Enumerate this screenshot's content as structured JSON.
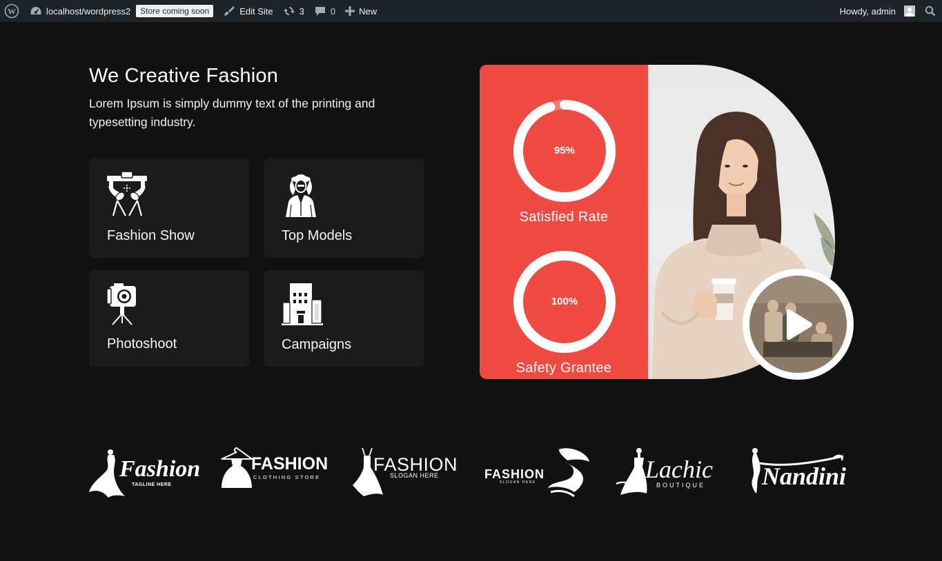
{
  "adminbar": {
    "site_name": "localhost/wordpress2",
    "store_badge": "Store coming soon",
    "edit_site": "Edit Site",
    "updates_count": "3",
    "comments_count": "0",
    "new_label": "New",
    "howdy": "Howdy, admin",
    "icons": [
      "wordpress-icon",
      "dashboard-icon",
      "brush-icon",
      "refresh-icon",
      "comment-icon",
      "plus-icon",
      "search-icon"
    ]
  },
  "hero": {
    "title": "We Creative Fashion",
    "text": "Lorem Ipsum is simply dummy text of the printing and typesetting industry."
  },
  "services": [
    {
      "label": "Fashion Show",
      "icon": "runway-lights-icon"
    },
    {
      "label": "Top Models",
      "icon": "model-icon"
    },
    {
      "label": "Photoshoot",
      "icon": "camera-tripod-icon"
    },
    {
      "label": "Campaigns",
      "icon": "building-icon"
    }
  ],
  "stats": [
    {
      "value": "95%",
      "label": "Satisfied Rate",
      "progress": 0.95
    },
    {
      "value": "100%",
      "label": "Safety Grantee",
      "progress": 1.0
    }
  ],
  "logos": [
    {
      "name": "Fashion",
      "tagline": "TAGLINE HERE"
    },
    {
      "name": "FASHION",
      "tagline": "CLOTHING STORE"
    },
    {
      "name": "FASHION",
      "tagline": "SLOGAN HERE"
    },
    {
      "name": "FASHION",
      "tagline": "SLOGAN HERE"
    },
    {
      "name": "Lachic",
      "tagline": "BOUTIQUE"
    },
    {
      "name": "Nandini",
      "tagline": ""
    }
  ],
  "colors": {
    "accent": "#ef4b42",
    "background": "#111111",
    "card": "#1b1b1b",
    "adminbar": "#1d2327"
  }
}
